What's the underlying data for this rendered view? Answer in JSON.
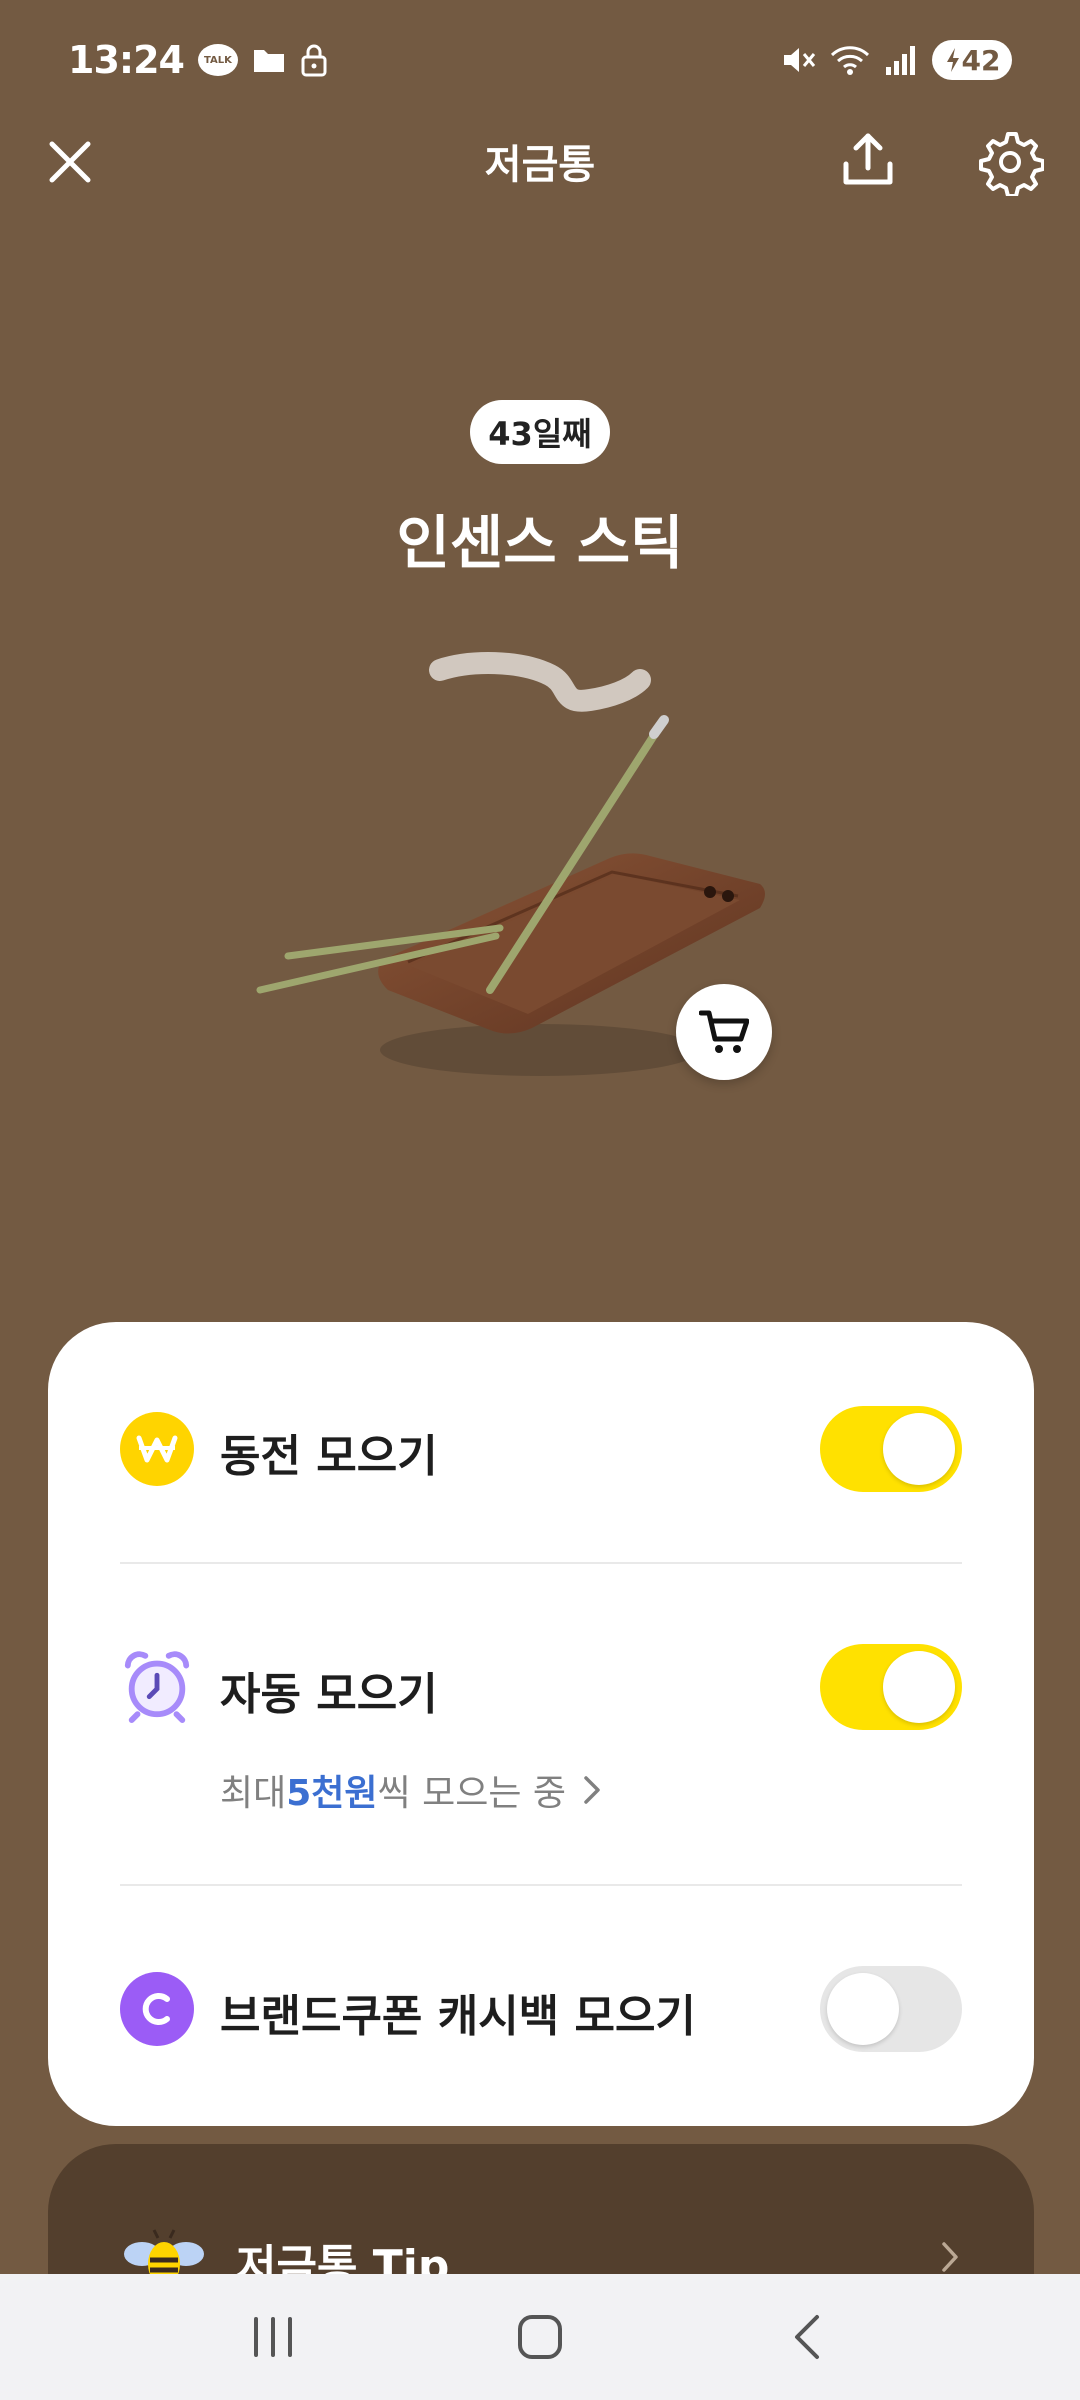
{
  "status_bar": {
    "time": "13:24",
    "talk_badge": "TALK",
    "battery": "42"
  },
  "header": {
    "title": "저금통"
  },
  "hero": {
    "day_badge": "43일째",
    "item_title": "인센스 스틱"
  },
  "savings_options": {
    "coin": {
      "label": "동전 모으기",
      "enabled": true
    },
    "auto": {
      "label": "자동 모으기",
      "enabled": true,
      "sub_prefix": "최대 ",
      "sub_highlight": "5천원",
      "sub_suffix": "씩 모으는 중"
    },
    "cashback": {
      "label": "브랜드쿠폰 캐시백 모으기",
      "enabled": false
    }
  },
  "tip": {
    "label": "저금통 Tip"
  },
  "colors": {
    "background": "#735a42",
    "toggle_on": "#ffe100",
    "highlight": "#3b6fd1",
    "coin_icon": "#ffd400",
    "alarm_icon": "#a78bfa",
    "cashback_icon": "#9b5cf6"
  },
  "icons": [
    "close-icon",
    "share-icon",
    "gear-icon",
    "cart-icon",
    "won-coin-icon",
    "alarm-clock-icon",
    "cashback-c-icon",
    "bee-icon",
    "chevron-right-icon",
    "recent-apps-icon",
    "home-icon",
    "back-icon"
  ]
}
